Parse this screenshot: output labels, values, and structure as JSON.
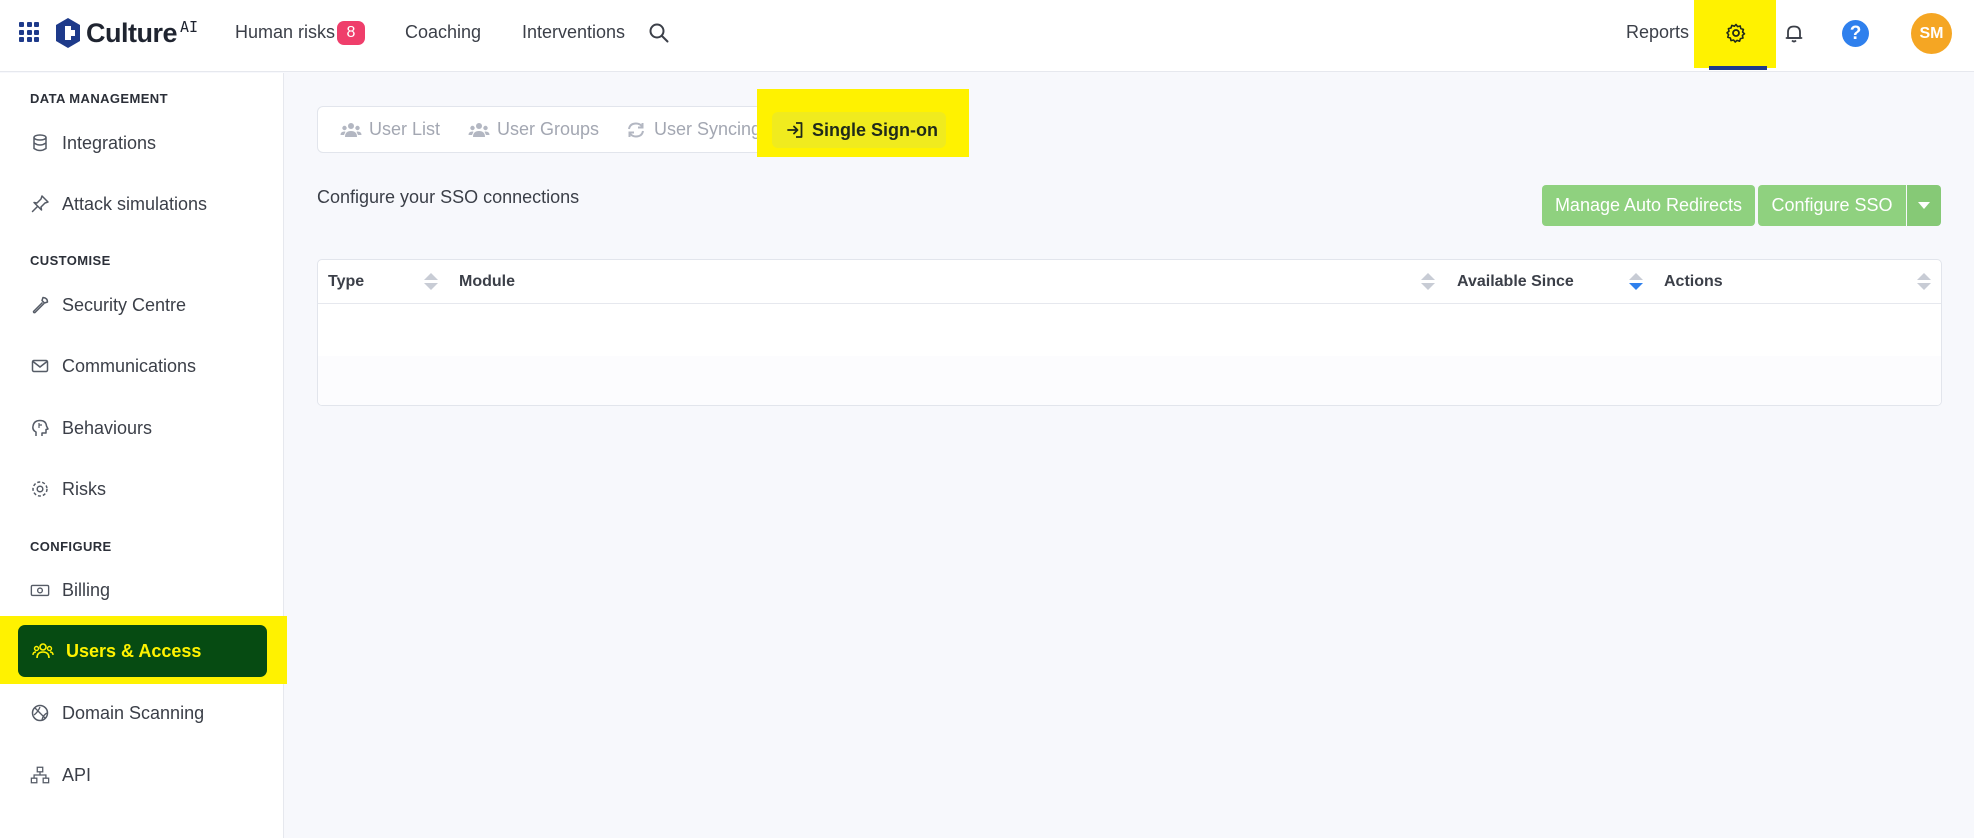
{
  "header": {
    "logo_text": "Culture",
    "logo_suffix": "AI",
    "nav": [
      {
        "label": "Human risks",
        "badge": "8"
      },
      {
        "label": "Coaching"
      },
      {
        "label": "Interventions"
      }
    ],
    "reports_label": "Reports",
    "avatar_initials": "SM",
    "help_label": "?"
  },
  "sidebar": {
    "sections": [
      {
        "title": "DATA MANAGEMENT",
        "items": [
          "Integrations",
          "Attack simulations"
        ]
      },
      {
        "title": "CUSTOMISE",
        "items": [
          "Security Centre",
          "Communications",
          "Behaviours",
          "Risks"
        ]
      },
      {
        "title": "CONFIGURE",
        "items": [
          "Billing",
          "Users & Access",
          "Domain Scanning",
          "API"
        ]
      }
    ],
    "active_item": "Users & Access"
  },
  "tabs": [
    {
      "label": "User List",
      "icon": "users-icon"
    },
    {
      "label": "User Groups",
      "icon": "users-icon"
    },
    {
      "label": "User Syncing",
      "icon": "sync-icon"
    },
    {
      "label": "Single Sign-on",
      "icon": "sign-in-icon",
      "active": true
    }
  ],
  "main": {
    "subtitle": "Configure your SSO connections",
    "buttons": {
      "manage_auto_redirects": "Manage Auto Redirects",
      "configure_sso": "Configure SSO"
    },
    "table": {
      "columns": [
        "Type",
        "Module",
        "Available Since",
        "Actions"
      ],
      "sorted_column": "Available Since",
      "rows": []
    }
  },
  "colors": {
    "highlight": "#fff200",
    "active_nav_bg": "#064b12",
    "button_green": "#8fd17f",
    "brand_blue": "#1e3a8a",
    "badge_pink": "#ef3e6b",
    "avatar_orange": "#f5a623"
  }
}
